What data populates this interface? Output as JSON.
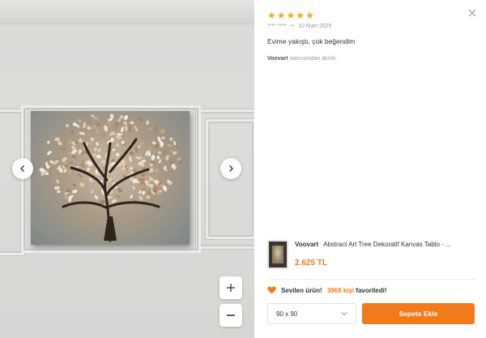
{
  "gallery": {
    "prev_icon": "chevron-left-icon",
    "next_icon": "chevron-right-icon",
    "zoom_in_label": "+",
    "zoom_out_label": "−"
  },
  "review": {
    "rating": 5,
    "star_glyph": "★",
    "author": "**** ****",
    "separator": "•",
    "date": "10 Mart 2025",
    "comment": "Evime yakıştı, çok beğendim",
    "seller_name": "Voovart",
    "seller_suffix": "satıcısından alındı."
  },
  "product": {
    "brand": "Voovart",
    "title": "Abstract Art Tree Dekoratif Kanvas Tablo - ...",
    "price": "2.625 TL"
  },
  "favorite": {
    "prefix": "Sevilen ürün!",
    "count": "3969 kişi",
    "suffix": "favoriledi!"
  },
  "actions": {
    "size_value": "90 x 90",
    "add_to_cart_label": "Sepete Ekle"
  },
  "colors": {
    "accent": "#f27a1a",
    "star": "#f5a623"
  }
}
